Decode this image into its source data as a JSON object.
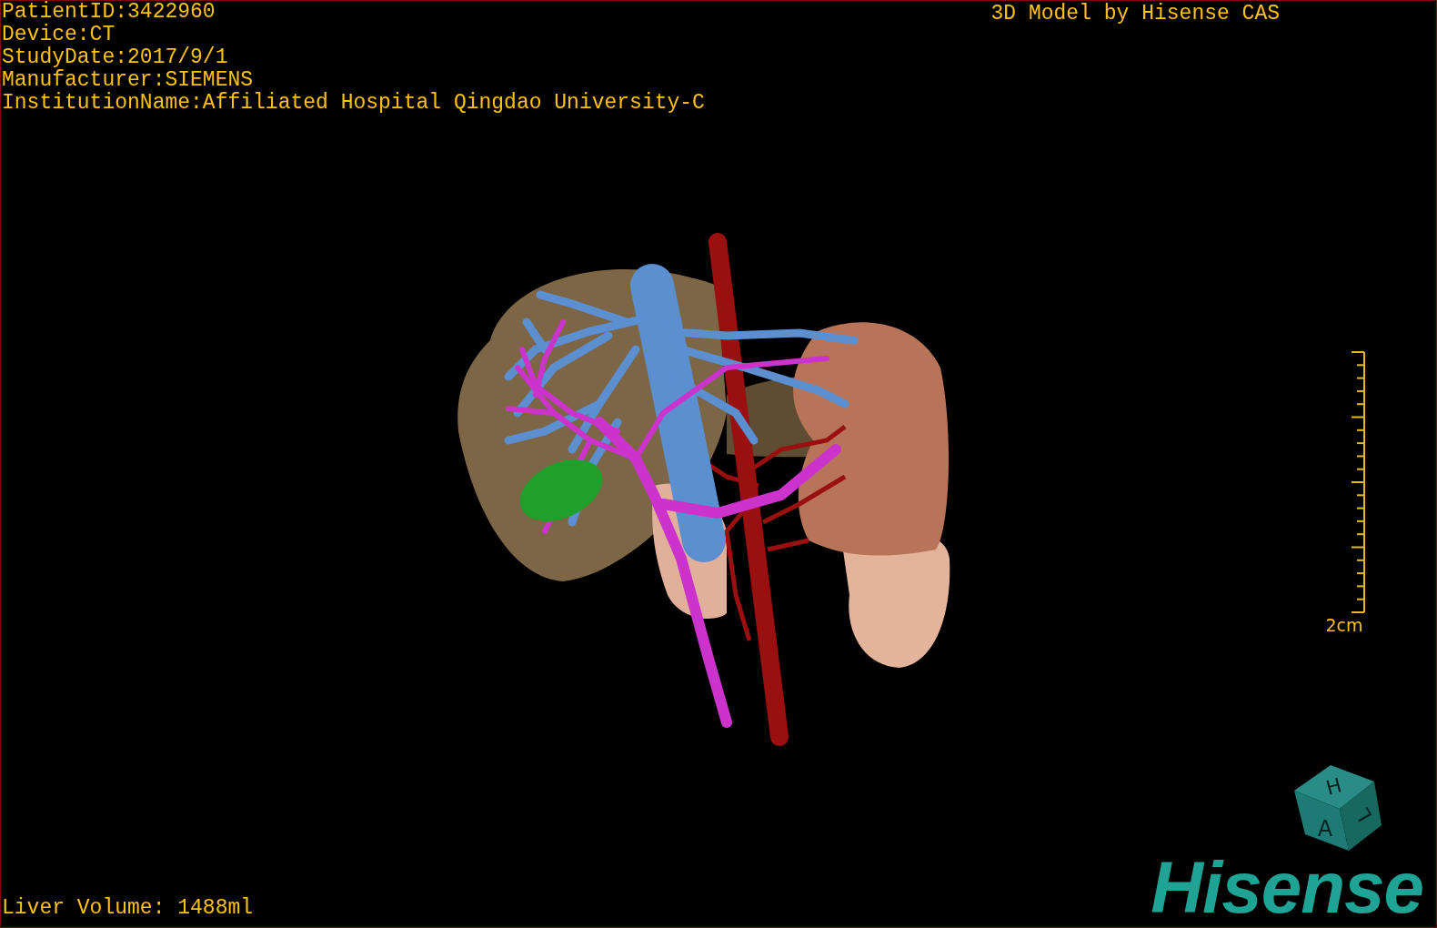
{
  "patient_info": [
    "PatientID:3422960",
    "Device:CT",
    "StudyDate:2017/9/1",
    "Manufacturer:SIEMENS",
    "InstitutionName:Affiliated Hospital Qingdao University-C"
  ],
  "header_right": "3D Model by Hisense CAS",
  "scale_bar": {
    "label": "2cm"
  },
  "liver_volume": "Liver Volume: 1488ml",
  "logo": {
    "cube_letters": [
      "H",
      "A",
      "L"
    ],
    "wordmark": "Hisense"
  }
}
